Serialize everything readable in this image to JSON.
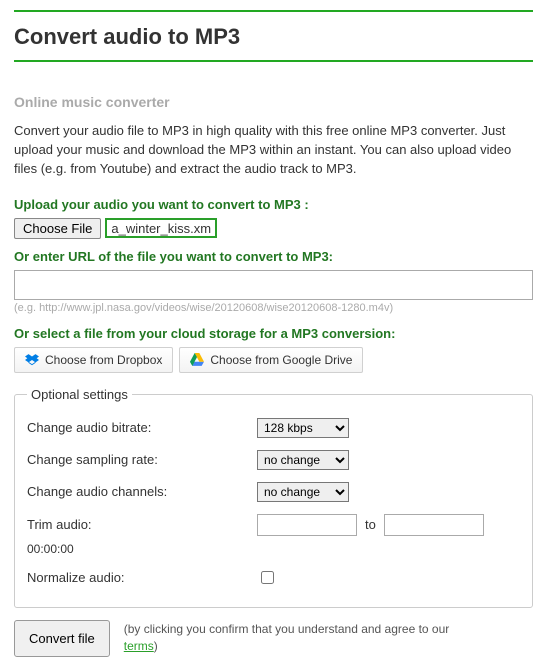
{
  "page": {
    "title": "Convert audio to MP3",
    "subtitle": "Online music converter",
    "intro": "Convert your audio file to MP3 in high quality with this free online MP3 converter. Just upload your music and download the MP3 within an instant. You can also upload video files (e.g. from Youtube) and extract the audio track to MP3."
  },
  "upload": {
    "label": "Upload your audio you want to convert to MP3 :",
    "choose_button": "Choose File",
    "file_name": "a_winter_kiss.xm"
  },
  "url": {
    "label": "Or enter URL of the file you want to convert to MP3:",
    "value": "",
    "hint": "(e.g.  http://www.jpl.nasa.gov/videos/wise/20120608/wise20120608-1280.m4v)"
  },
  "cloud": {
    "label": "Or select a file from your cloud storage for a MP3 conversion:",
    "dropbox": "Choose from Dropbox",
    "gdrive": "Choose from Google Drive"
  },
  "settings": {
    "legend": "Optional settings",
    "bitrate": {
      "label": "Change audio bitrate:",
      "value": "128 kbps"
    },
    "sampling": {
      "label": "Change sampling rate:",
      "value": "no change"
    },
    "channels": {
      "label": "Change audio channels:",
      "value": "no change"
    },
    "trim": {
      "label": "Trim audio:",
      "from": "",
      "to_label": "to",
      "to": ""
    },
    "timecode": "00:00:00",
    "normalize": {
      "label": "Normalize audio:",
      "checked": false
    }
  },
  "submit": {
    "button": "Convert file",
    "disclaimer_prefix": "(by clicking you confirm that you understand and agree to our ",
    "terms_text": "terms",
    "disclaimer_suffix": ")"
  }
}
